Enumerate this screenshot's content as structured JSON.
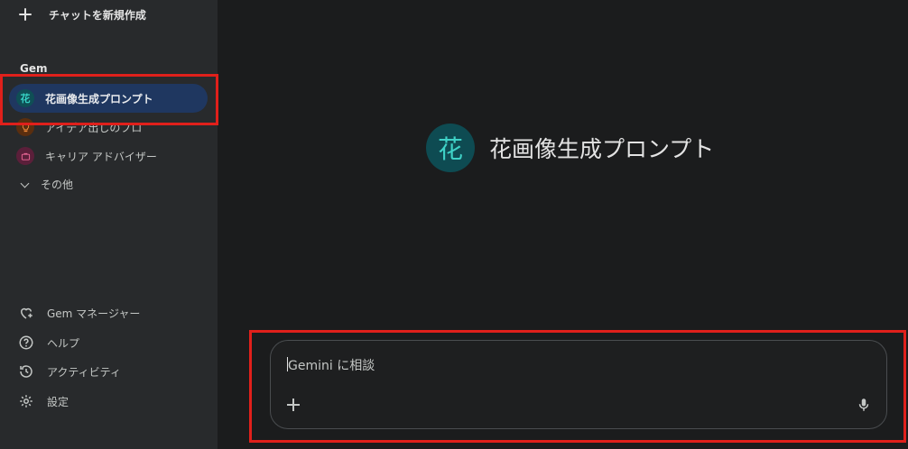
{
  "sidebar": {
    "new_chat_label": "チャットを新規作成",
    "section_title": "Gem",
    "gems": [
      {
        "label": "花画像生成プロンプト",
        "icon_text": "花",
        "icon": "flower-gem-icon",
        "active": true
      },
      {
        "label": "アイデア出しのプロ",
        "icon_text": "💡",
        "icon": "lightbulb-icon",
        "active": false
      },
      {
        "label": "キャリア アドバイザー",
        "icon_text": "💼",
        "icon": "briefcase-icon",
        "active": false
      }
    ],
    "others_label": "その他",
    "bottom": [
      {
        "label": "Gem マネージャー",
        "icon": "gem-manager-icon"
      },
      {
        "label": "ヘルプ",
        "icon": "help-icon"
      },
      {
        "label": "アクティビティ",
        "icon": "activity-icon"
      },
      {
        "label": "設定",
        "icon": "settings-icon"
      }
    ]
  },
  "main": {
    "gem_avatar_text": "花",
    "gem_name": "花画像生成プロンプト",
    "input_placeholder": "Gemini に相談"
  },
  "colors": {
    "highlight": "#e0201b",
    "active_item_bg": "#1f3760",
    "teal_accent": "#3fd2c7"
  }
}
